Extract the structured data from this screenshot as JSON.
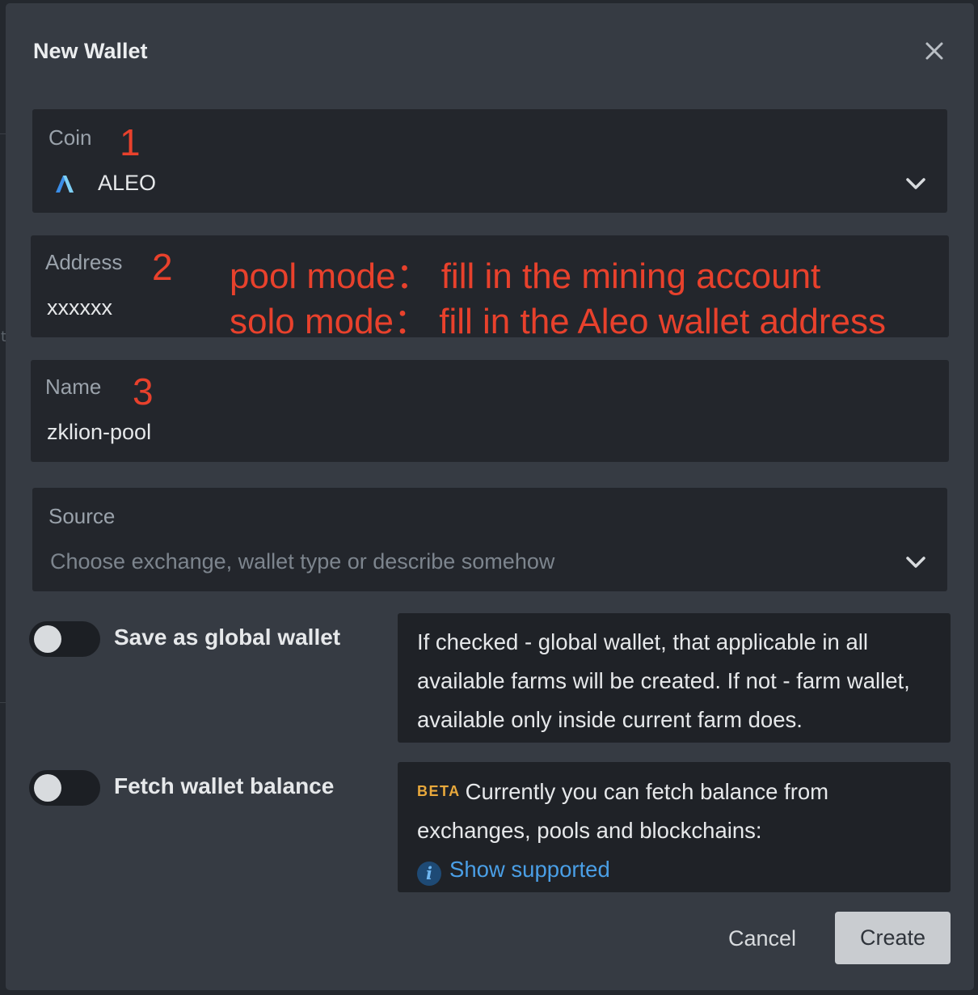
{
  "dialog": {
    "title": "New Wallet"
  },
  "coin_field": {
    "label": "Coin",
    "value": "ALEO",
    "annotation": "1"
  },
  "address_field": {
    "label": "Address",
    "value": "xxxxxx",
    "annotation_number": "2",
    "annotation_line1": "pool mode：  fill in the mining account",
    "annotation_line2": "solo mode：  fill in the Aleo wallet address"
  },
  "name_field": {
    "label": "Name",
    "value": "zklion-pool",
    "annotation": "3"
  },
  "source_field": {
    "label": "Source",
    "placeholder": "Choose exchange, wallet type or describe somehow"
  },
  "global_toggle": {
    "label": "Save as global wallet",
    "checked": false,
    "help": "If checked - global wallet, that applicable in all available farms will be created. If not - farm wallet, available only inside current farm does."
  },
  "balance_toggle": {
    "label": "Fetch wallet balance",
    "checked": false,
    "badge": "BETA",
    "help": "Currently you can fetch balance from exchanges, pools and blockchains:",
    "link_icon": "i",
    "link": "Show supported"
  },
  "footer": {
    "cancel_label": "Cancel",
    "create_label": "Create"
  },
  "icons": {
    "close": "close-icon",
    "chevron": "chevron-down-icon",
    "coin": "aleo-logo-icon",
    "info": "info-icon"
  },
  "colors": {
    "modal_bg": "#363b43",
    "field_bg": "#23262c",
    "annotation": "#e8412c",
    "link": "#4a9fe6",
    "beta": "#e9a93c"
  }
}
